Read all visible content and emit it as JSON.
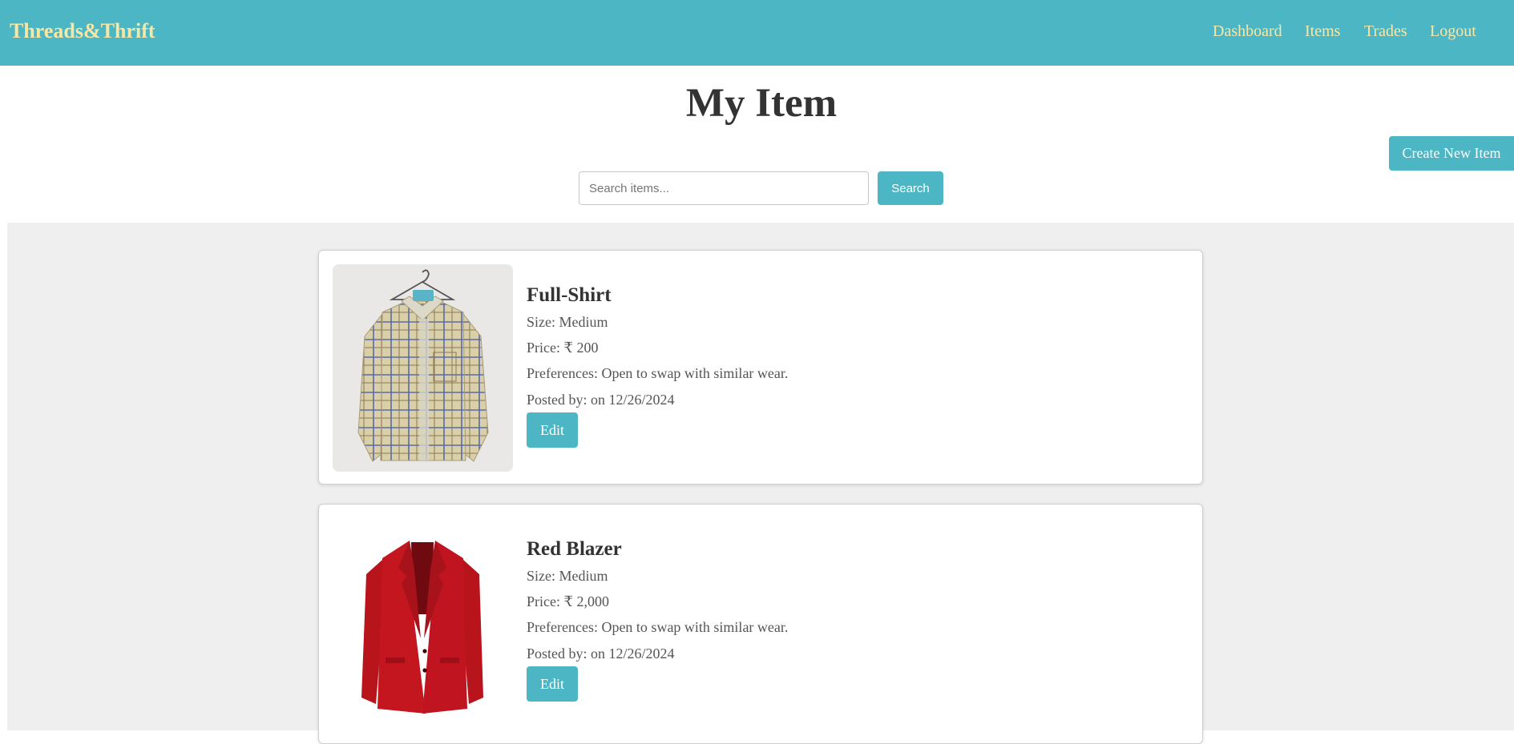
{
  "header": {
    "brand": "Threads&Thrift",
    "nav": [
      "Dashboard",
      "Items",
      "Trades",
      "Logout"
    ]
  },
  "page": {
    "title": "My Item",
    "create_button": "Create New Item"
  },
  "search": {
    "placeholder": "Search items...",
    "value": "",
    "button_label": "Search"
  },
  "items": [
    {
      "title": "Full-Shirt",
      "size": "Size: Medium",
      "price": "Price: ₹ 200",
      "preferences": "Preferences: Open to swap with similar wear.",
      "posted": "Posted by: on 12/26/2024",
      "edit_label": "Edit"
    },
    {
      "title": "Red Blazer",
      "size": "Size: Medium",
      "price": "Price: ₹ 2,000",
      "preferences": "Preferences: Open to swap with similar wear.",
      "posted": "Posted by: on 12/26/2024",
      "edit_label": "Edit"
    }
  ],
  "colors": {
    "accent": "#4db6c4",
    "brand_text": "#f7e7a6",
    "list_background": "#efefef"
  }
}
